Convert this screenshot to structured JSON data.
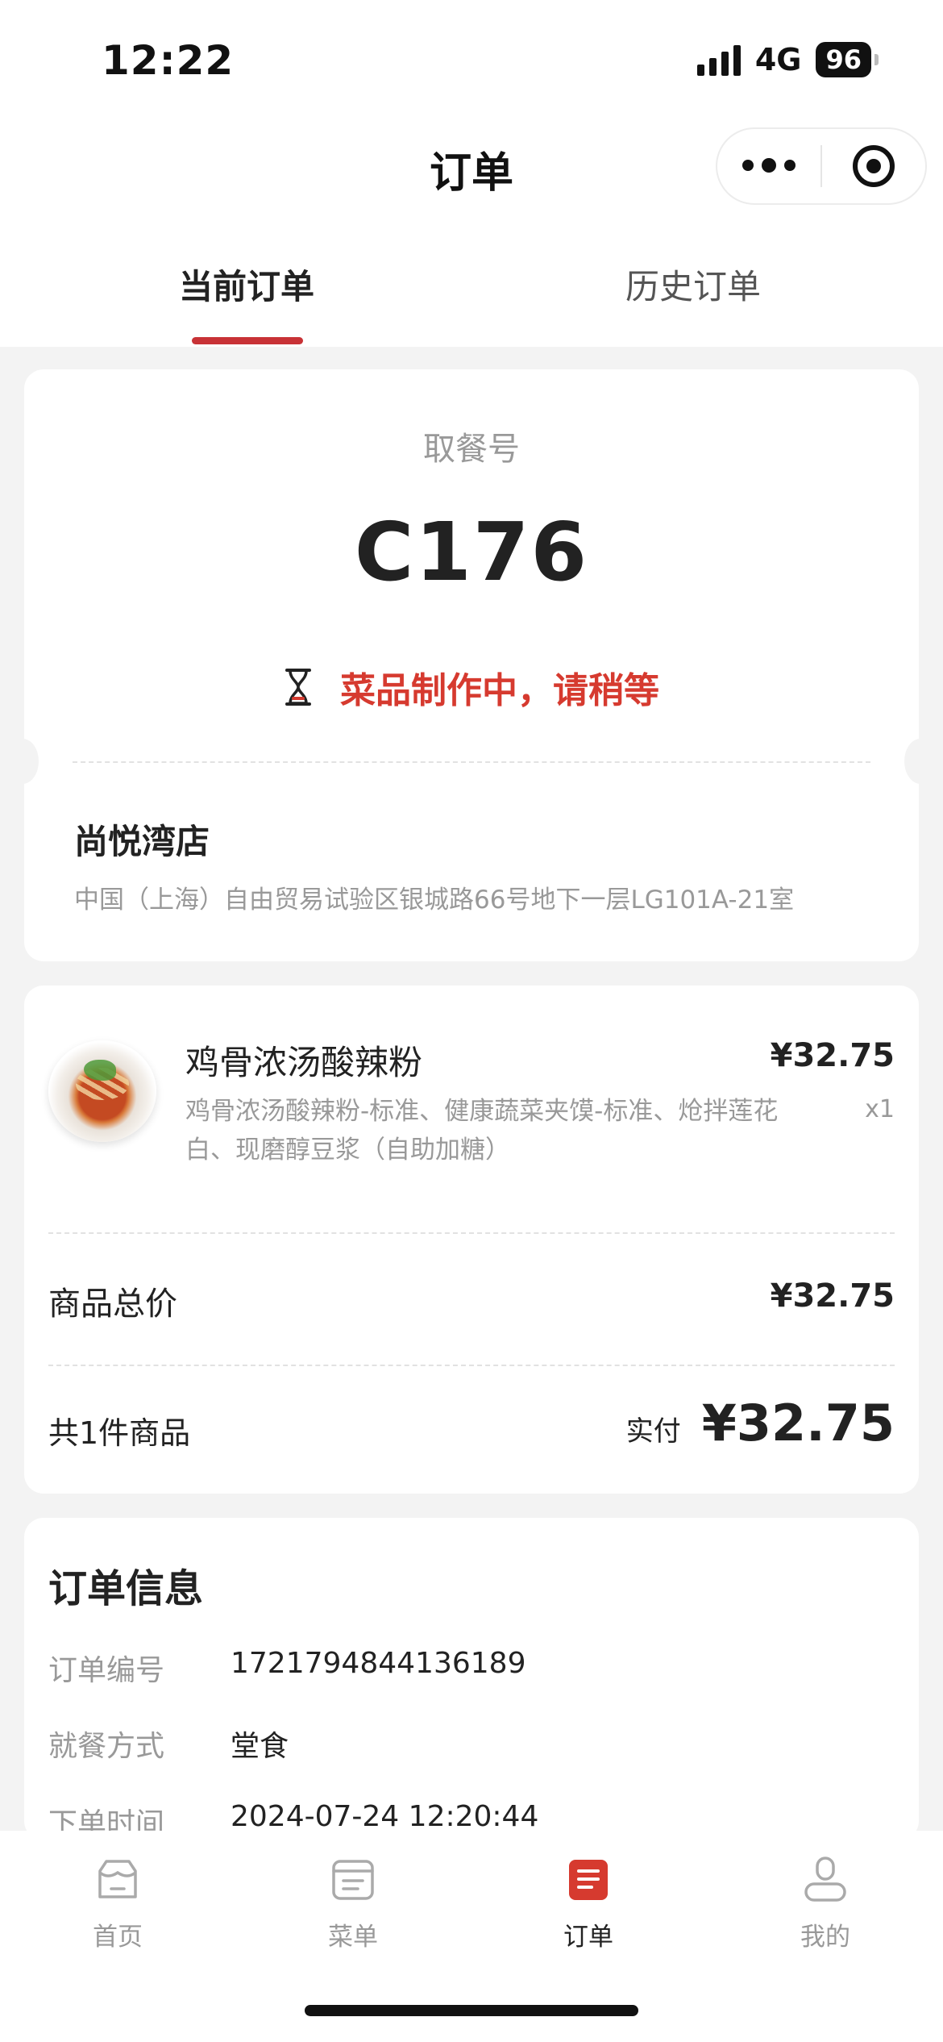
{
  "status_bar": {
    "time": "12:22",
    "network": "4G",
    "battery": "96"
  },
  "header": {
    "title": "订单"
  },
  "tabs": {
    "current": "当前订单",
    "history": "历史订单"
  },
  "pickup": {
    "label": "取餐号",
    "number": "C176",
    "status": "菜品制作中，请稍等",
    "status_color": "#d63a2f"
  },
  "store": {
    "name": "尚悦湾店",
    "address": "中国（上海）自由贸易试验区银城路66号地下一层LG101A-21室"
  },
  "item": {
    "name": "鸡骨浓汤酸辣粉",
    "price": "¥32.75",
    "description": "鸡骨浓汤酸辣粉-标准、健康蔬菜夹馍-标准、炝拌莲花白、现磨醇豆浆（自助加糖）",
    "quantity": "x1"
  },
  "totals": {
    "subtotal_label": "商品总价",
    "subtotal_value": "¥32.75",
    "count_label": "共1件商品",
    "paid_label": "实付",
    "paid_value": "¥32.75"
  },
  "order_info": {
    "title": "订单信息",
    "rows": [
      {
        "key": "订单编号",
        "value": "1721794844136189"
      },
      {
        "key": "就餐方式",
        "value": "堂食"
      },
      {
        "key": "下单时间",
        "value": "2024-07-24 12:20:44"
      }
    ]
  },
  "nav": {
    "items": [
      {
        "label": "首页",
        "icon": "home-icon"
      },
      {
        "label": "菜单",
        "icon": "menu-icon"
      },
      {
        "label": "订单",
        "icon": "order-icon",
        "active": true
      },
      {
        "label": "我的",
        "icon": "profile-icon"
      }
    ],
    "accent": "#d63a2f"
  }
}
